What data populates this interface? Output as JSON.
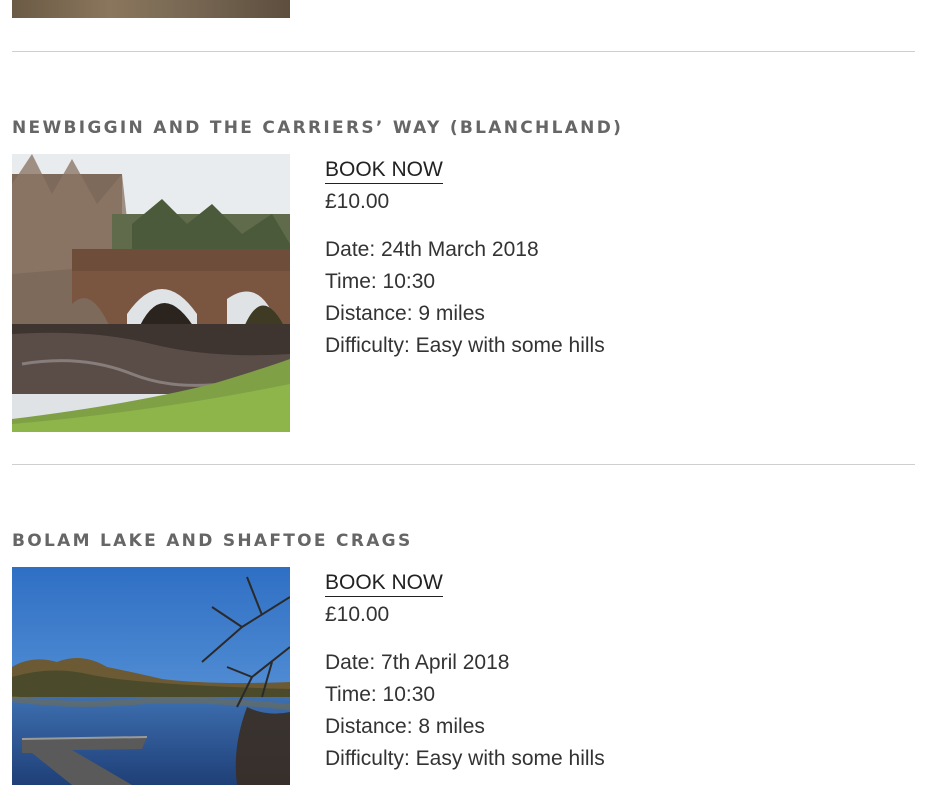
{
  "walks": [
    {
      "title": "NEWBIGGIN AND THE CARRIERS’ WAY (BLANCHLAND)",
      "book_label": "BOOK NOW",
      "price": "£10.00",
      "date": "Date: 24th March 2018",
      "time": "Time: 10:30",
      "distance": "Distance: 9 miles",
      "difficulty": "Difficulty: Easy with some hills"
    },
    {
      "title": "BOLAM LAKE AND SHAFTOE CRAGS",
      "book_label": "BOOK NOW",
      "price": "£10.00",
      "date": "Date: 7th April 2018",
      "time": "Time: 10:30",
      "distance": "Distance: 8 miles",
      "difficulty": "Difficulty: Easy with some hills"
    }
  ]
}
